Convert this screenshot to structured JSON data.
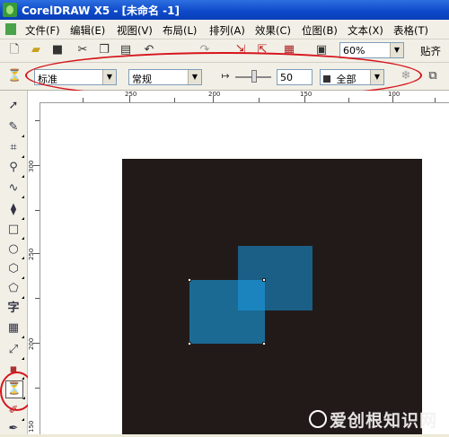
{
  "window": {
    "title": "CorelDRAW X5 - [未命名 -1]"
  },
  "menubar": {
    "items": [
      "文件(F)",
      "编辑(E)",
      "视图(V)",
      "布局(L)",
      "排列(A)",
      "效果(C)",
      "位图(B)",
      "文本(X)",
      "表格(T)"
    ]
  },
  "standard_toolbar": {
    "zoom_value": "60%",
    "snap_label": "贴齐",
    "icons": [
      "new-icon",
      "open-icon",
      "save-icon",
      "cut-icon",
      "copy-icon",
      "paste-icon",
      "undo-icon",
      "redo-icon",
      "import-icon",
      "export-icon",
      "app-launcher-icon",
      "welcome-icon"
    ]
  },
  "property_bar": {
    "transparency_type": "标准",
    "merge_mode": "常规",
    "transparency_value": "50",
    "apply_target": "全部"
  },
  "rulers": {
    "horizontal_labels": [
      "250",
      "200",
      "150",
      "100"
    ],
    "vertical_labels": [
      "300",
      "250",
      "200",
      "150"
    ]
  },
  "toolbox": {
    "tools": [
      "pick-tool-icon",
      "shape-tool-icon",
      "crop-tool-icon",
      "zoom-tool-icon",
      "freehand-tool-icon",
      "smart-fill-tool-icon",
      "rectangle-tool-icon",
      "ellipse-tool-icon",
      "polygon-tool-icon",
      "basic-shapes-tool-icon",
      "text-tool-icon",
      "table-tool-icon",
      "dimension-tool-icon",
      "interactive-tool-icon",
      "transparency-tool-icon",
      "eyedropper-tool-icon",
      "outline-tool-icon"
    ],
    "text_tool_label": "字"
  },
  "colors": {
    "page_background": "#221a18",
    "square_back": "#1b5e86",
    "square_front": "#1a6a94",
    "square_overlap": "#1b84bf",
    "annotation_red": "#d6151d"
  },
  "watermark": {
    "text": "爱创根知识网"
  }
}
